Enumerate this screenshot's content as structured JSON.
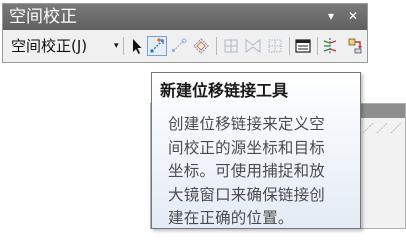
{
  "window": {
    "title": "空间校正",
    "dropdown_icon": "dropdown-arrow-icon",
    "close_icon": "close-icon"
  },
  "toolbar": {
    "menu_label": "空间校正(J)",
    "menu_caret": "▾",
    "tools": [
      {
        "name": "select-elements-tool",
        "icon": "arrow-pointer-icon"
      },
      {
        "name": "new-displacement-link-tool",
        "icon": "new-link-icon",
        "pressed": true
      },
      {
        "name": "modify-link-tool",
        "icon": "modify-link-icon"
      },
      {
        "name": "multi-displacement-link-tool",
        "icon": "multi-link-icon"
      },
      {
        "name": "new-identity-link-tool",
        "icon": "grid-icon"
      },
      {
        "name": "new-limited-adjustment-tool",
        "icon": "bowtie-icon"
      },
      {
        "name": "clear-selected-links-tool",
        "icon": "dotted-grid-icon"
      },
      {
        "name": "view-link-table-tool",
        "icon": "link-table-icon"
      },
      {
        "name": "edge-match-tool",
        "icon": "edge-match-icon"
      },
      {
        "name": "attribute-transfer-tool",
        "icon": "attribute-transfer-icon"
      }
    ]
  },
  "tooltip": {
    "title": "新建位移链接工具",
    "body_lines": [
      "创建位移链接来定义空",
      "间校正的源坐标和目标",
      "坐标。可使用捕捉和放",
      "大镜窗口来确保链接创",
      "建在正确的位置。"
    ]
  },
  "colors": {
    "titlebar": "#6b6b6b",
    "toolbar_bg": "#f0f0f0",
    "tooltip_bg_top": "#ffffff",
    "tooltip_bg_bottom": "#e4ebf6",
    "tooltip_text": "#4c4c4c"
  }
}
